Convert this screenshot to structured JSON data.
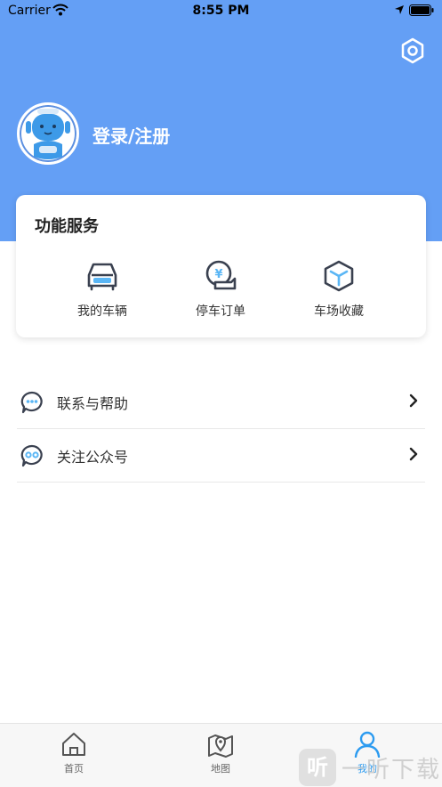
{
  "status_bar": {
    "carrier": "Carrier",
    "time": "8:55 PM"
  },
  "header": {
    "login_label": "登录/注册",
    "background_color": "#649ff5"
  },
  "services": {
    "title": "功能服务",
    "items": [
      {
        "label": "我的车辆",
        "icon": "car-icon"
      },
      {
        "label": "停车订单",
        "icon": "parking-order-icon"
      },
      {
        "label": "车场收藏",
        "icon": "favorite-lot-icon"
      }
    ]
  },
  "menu": {
    "items": [
      {
        "label": "联系与帮助",
        "icon": "chat-bubble-icon"
      },
      {
        "label": "关注公众号",
        "icon": "official-account-icon"
      }
    ]
  },
  "tab_bar": {
    "tabs": [
      {
        "label": "首页",
        "icon": "home-icon",
        "active": false
      },
      {
        "label": "地图",
        "icon": "map-icon",
        "active": false
      },
      {
        "label": "我的",
        "icon": "profile-icon",
        "active": true
      }
    ],
    "active_color": "#2c9bf0"
  },
  "watermark": {
    "logo": "听",
    "text": "一听下载"
  }
}
